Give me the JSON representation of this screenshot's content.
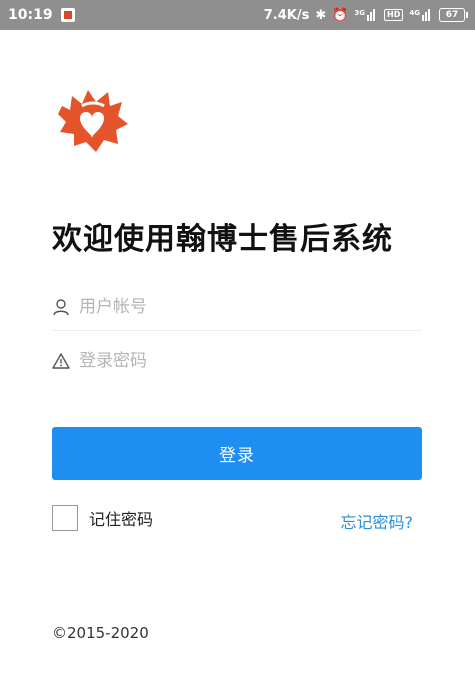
{
  "status_bar": {
    "time": "10:19",
    "network_speed": "7.4K/s",
    "sim1_tag": "3G",
    "sim2_tag": "4G",
    "hd_label": "HD",
    "battery": "67"
  },
  "login": {
    "title": "欢迎使用翰博士售后系统",
    "username_placeholder": "用户帐号",
    "password_placeholder": "登录密码",
    "login_button": "登录",
    "remember_label": "记住密码",
    "remember_checked": false,
    "forgot_link": "忘记密码?"
  },
  "footer": {
    "copyright": "©2015-2020"
  },
  "colors": {
    "primary": "#1f8ef1",
    "link": "#2a8fd8",
    "logo": "#e5532a",
    "statusbar": "#8f8f8f"
  }
}
